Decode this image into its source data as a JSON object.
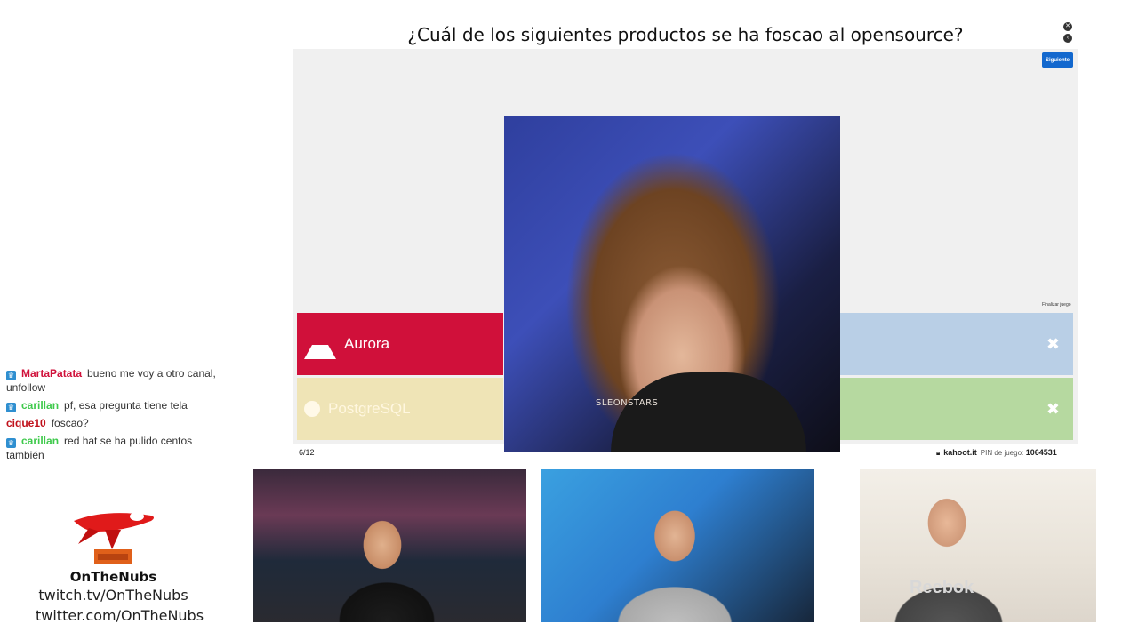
{
  "quiz": {
    "question": "¿Cuál de los siguientes productos se ha foscao al opensource?",
    "next_label": "Siguiente",
    "end_game_label": "Finalizar juego",
    "progress": "6/12",
    "site": "kahoot.it",
    "pin_label": "PIN de juego:",
    "pin": "1064531",
    "answers": [
      {
        "label": "Aurora",
        "shape": "triangle-icon",
        "color": "#d0103a"
      },
      {
        "label": "PostgreSQL",
        "shape": "circle-icon",
        "color": "#efe4b6"
      },
      {
        "label": "",
        "shape": "close-icon",
        "color": "#b9cfe6"
      },
      {
        "label": "",
        "shape": "close-icon",
        "color": "#b6d9a0"
      }
    ],
    "overlay_watermark": "SLEONSTARS"
  },
  "chat": {
    "messages": [
      {
        "user": "MartaPatata",
        "user_color": "#d0103a",
        "text": "bueno me voy a otro canal, unfollow",
        "badge": true
      },
      {
        "user": "carillan",
        "user_color": "#3ec94b",
        "text": "pf, esa pregunta tiene tela",
        "badge": true
      },
      {
        "user": "cique10",
        "user_color": "#c0101a",
        "text": "foscao?",
        "badge": false
      },
      {
        "user": "carillan",
        "user_color": "#3ec94b",
        "text": "red hat se ha pulido centos también",
        "badge": true
      }
    ]
  },
  "brand": {
    "name": "OnTheNubs",
    "twitch": "twitch.tv/OnTheNubs",
    "twitter": "twitter.com/OnTheNubs"
  },
  "webcams": {
    "shirt_text": "Reebok"
  }
}
